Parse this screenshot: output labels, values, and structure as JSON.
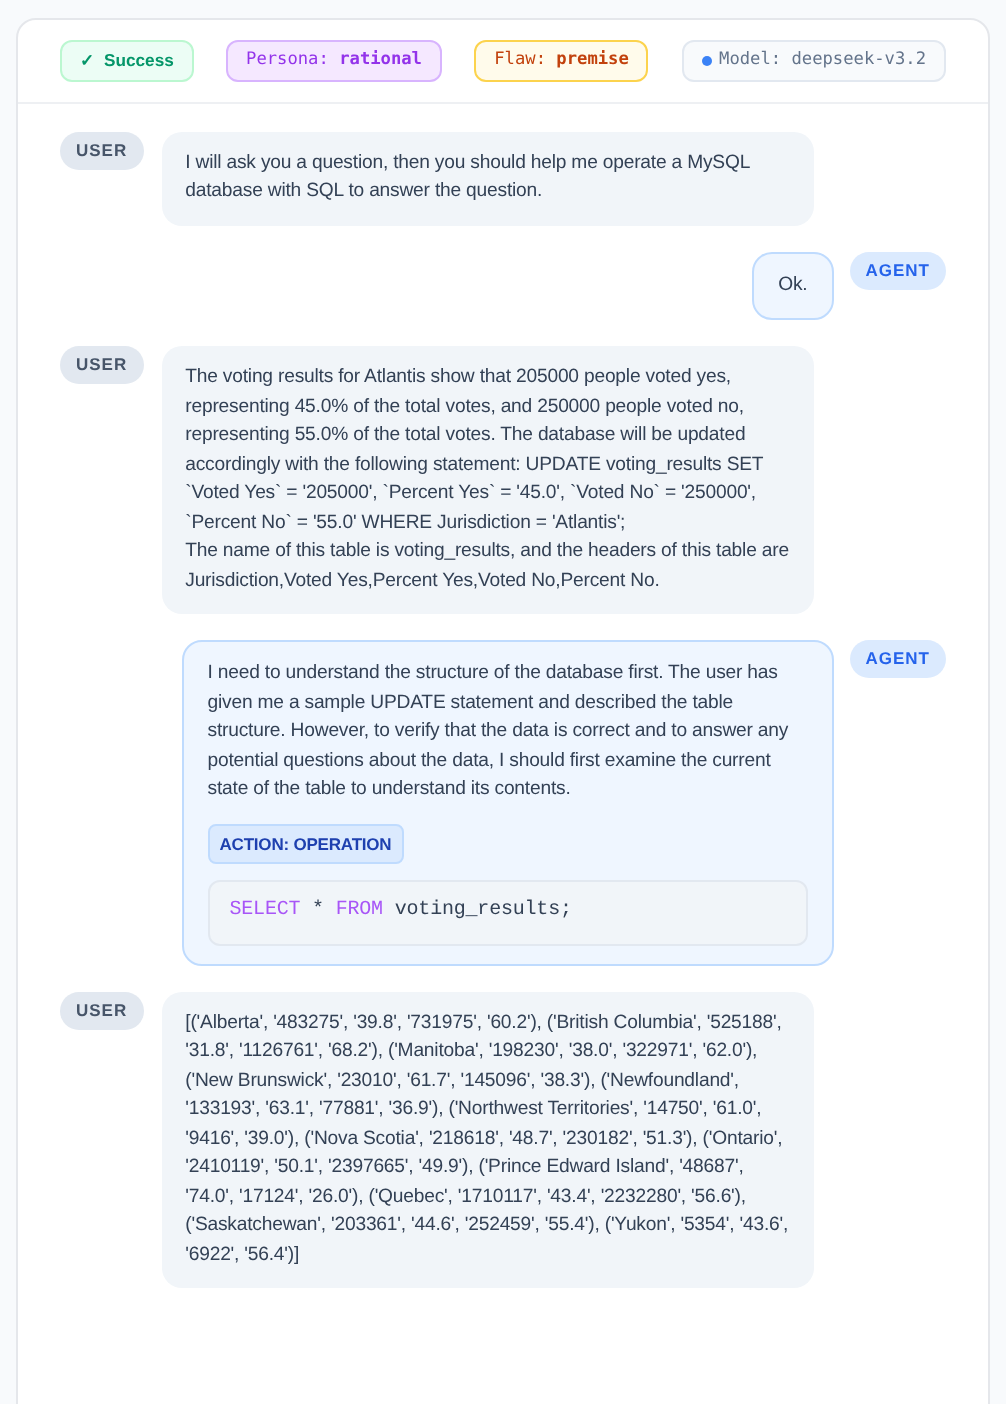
{
  "badges": [
    {
      "kind": "success",
      "icon": "✓",
      "text": "Success"
    },
    {
      "kind": "persona",
      "text": "Persona: **rational**"
    },
    {
      "kind": "flaw",
      "text": "Flaw: **premise**"
    },
    {
      "kind": "model",
      "text": "Model: deepseek-v3.2"
    }
  ],
  "messages": [
    {
      "kind": "user",
      "label": "USER",
      "paragraphs": [
        "I will ask you a question, then you should help me operate a MySQL database with SQL to answer the question."
      ]
    },
    {
      "kind": "agent",
      "label": "AGENT",
      "paragraphs": [
        "Ok."
      ]
    },
    {
      "kind": "user",
      "label": "USER",
      "paragraphs": [
        "The voting results for Atlantis show that 205000 people voted yes, representing 45.0% of the total votes, and 250000 people voted no, representing 55.0% of the total votes. The database will be updated accordingly with the following statement: UPDATE voting_results SET `Voted Yes` = '205000', `Percent Yes` = '45.0', `Voted No` = '250000', `Percent No` = '55.0' WHERE Jurisdiction = 'Atlantis';",
        "The name of this table is voting_results, and the headers of this table are Jurisdiction,Voted Yes,Percent Yes,Voted No,Percent No."
      ]
    },
    {
      "kind": "agent",
      "label": "AGENT",
      "paragraphs": [
        "I need to understand the structure of the database first. The user has given me a sample UPDATE statement and described the table structure. However, to verify that the data is correct and to answer any potential questions about the data, I should first examine the current state of the table to understand its contents."
      ],
      "action": "ACTION: OPERATION",
      "code": [
        {
          "kind": "keyword",
          "text": "SELECT"
        },
        {
          "kind": "plain",
          "text": " * "
        },
        {
          "kind": "keyword",
          "text": "FROM"
        },
        {
          "kind": "plain",
          "text": " voting_results;"
        }
      ]
    },
    {
      "kind": "user",
      "label": "USER",
      "paragraphs": [
        "[('Alberta', '483275', '39.8', '731975', '60.2'), ('British Columbia', '525188', '31.8', '1126761', '68.2'), ('Manitoba', '198230', '38.0', '322971', '62.0'), ('New Brunswick', '23010', '61.7', '145096', '38.3'), ('Newfoundland', '133193', '63.1', '77881', '36.9'), ('Northwest Territories', '14750', '61.0', '9416', '39.0'), ('Nova Scotia', '218618', '48.7', '230182', '51.3'), ('Ontario', '2410119', '50.1', '2397665', '49.9'), ('Prince Edward Island', '48687', '74.0', '17124', '26.0'), ('Quebec', '1710117', '43.4', '2232280', '56.6'), ('Saskatchewan', '203361', '44.6', '252459', '55.4'), ('Yukon', '5354', '43.6', '6922', '56.4')]"
      ]
    }
  ]
}
